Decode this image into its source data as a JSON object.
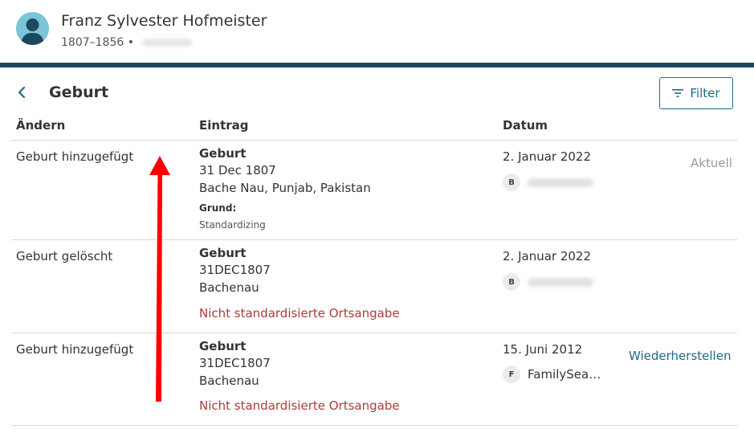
{
  "person": {
    "name": "Franz Sylvester Hofmeister",
    "lifespan": "1807–1856 •"
  },
  "section": {
    "title": "Geburt"
  },
  "toolbar": {
    "filter_label": "Filter"
  },
  "columns": {
    "change": "Ändern",
    "entry": "Eintrag",
    "date": "Datum"
  },
  "rows": [
    {
      "change": "Geburt hinzugefügt",
      "entry_title": "Geburt",
      "entry_date": "31 Dec 1807",
      "entry_place": "Bache Nau, Punjab, Pakistan",
      "reason_label": "Grund:",
      "reason_text": "Standardizing",
      "date": "2. Januar 2022",
      "contributor_initial": "B",
      "status": "Aktuell"
    },
    {
      "change": "Geburt gelöscht",
      "entry_title": "Geburt",
      "entry_date": "31DEC1807",
      "entry_place": "Bachenau",
      "warning": "Nicht standardisierte Ortsangabe",
      "date": "2. Januar 2022",
      "contributor_initial": "B"
    },
    {
      "change": "Geburt hinzugefügt",
      "entry_title": "Geburt",
      "entry_date": "31DEC1807",
      "entry_place": "Bachenau",
      "warning": "Nicht standardisierte Ortsangabe",
      "date": "15. Juni 2012",
      "contributor_initial": "F",
      "contributor_name": "FamilySea…",
      "action": "Wiederherstellen"
    }
  ],
  "colors": {
    "accent": "#1e6a8a",
    "header_rule": "#1b4860",
    "warning": "#b03a3a",
    "annotation_arrow": "#ff0000"
  },
  "icons": {
    "back": "chevron-left-icon",
    "filter": "filter-lines-icon",
    "avatar": "person-silhouette-icon",
    "annotation": "red-arrow-up"
  }
}
